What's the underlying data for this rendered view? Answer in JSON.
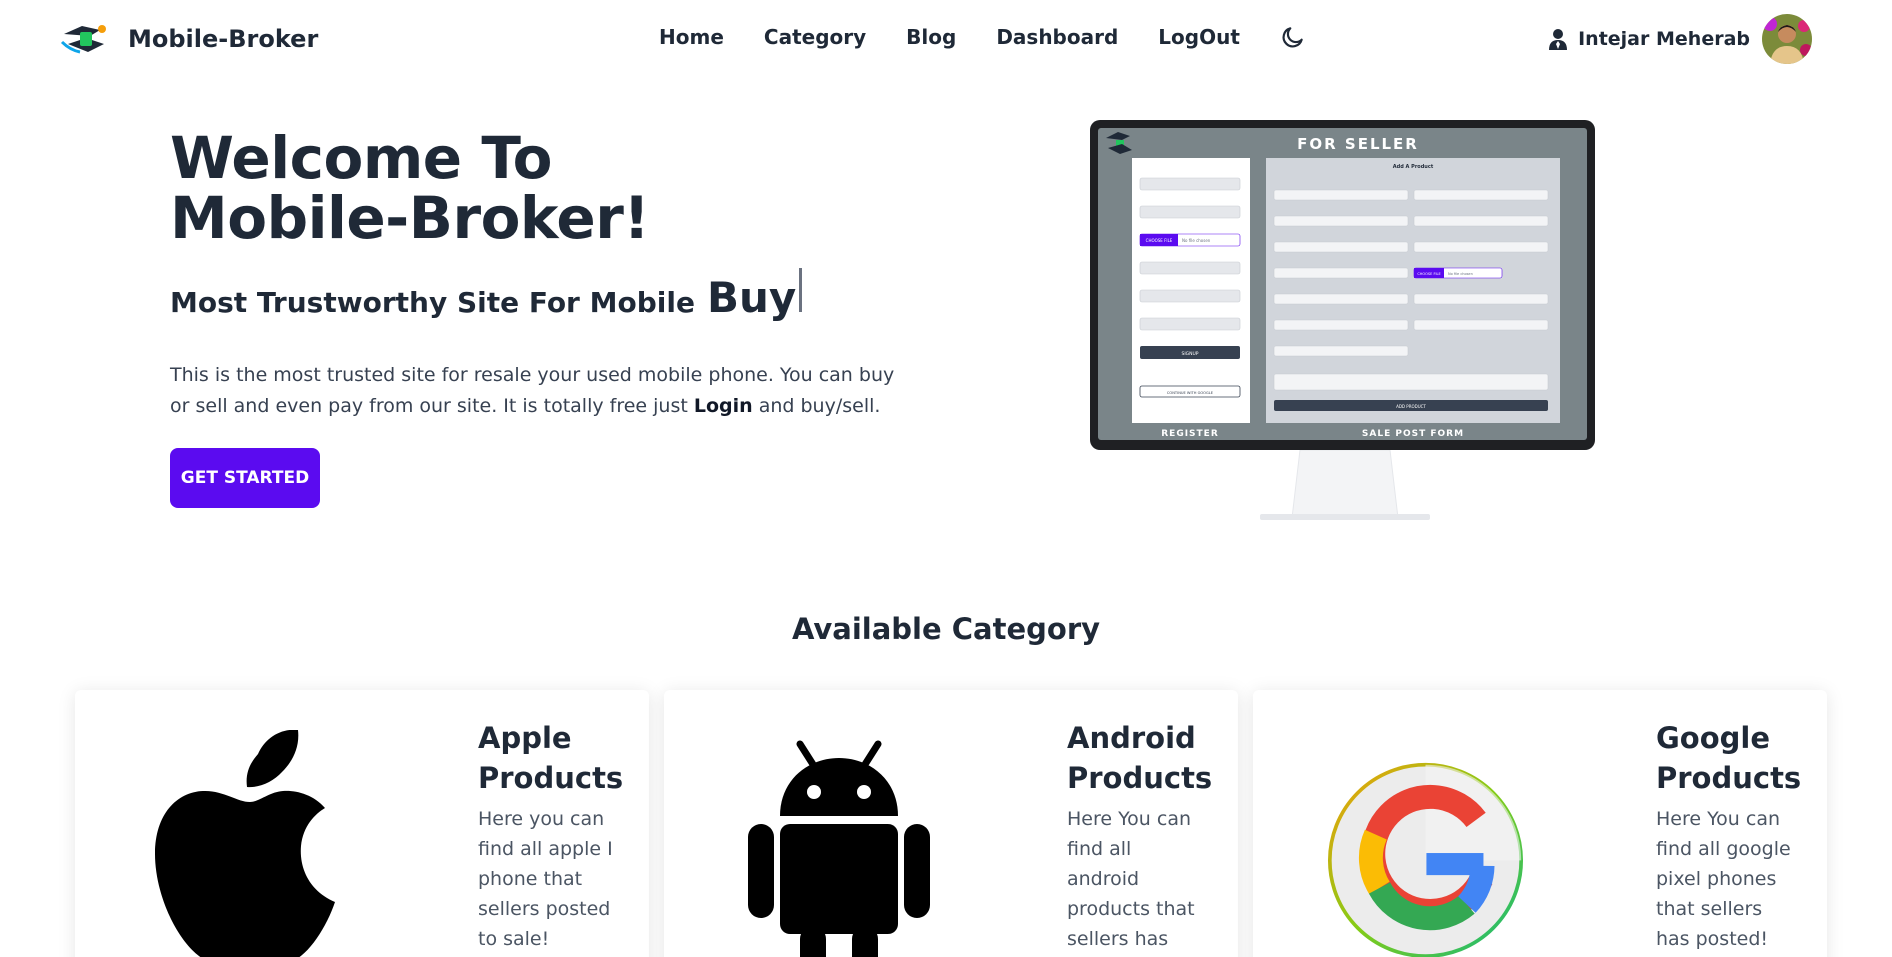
{
  "nav": {
    "brand": "Mobile-Broker",
    "links": [
      "Home",
      "Category",
      "Blog",
      "Dashboard",
      "LogOut"
    ],
    "user_name": "Intejar Meherab"
  },
  "hero": {
    "title": "Welcome To Mobile-Broker!",
    "subtitle": "Most Trustworthy Site For Mobile",
    "typed_word": "Buy",
    "description_part1": "This is the most trusted site for resale your used mobile phone. You can buy or sell and even pay from our site. It is totally free just",
    "description_bold": "Login",
    "description_part2": "and buy/sell.",
    "cta": "GET STARTED"
  },
  "showcase": {
    "left_caption": "REGISTER",
    "right_caption": "SALE POST FORM",
    "banner": "FOR SELLER",
    "form_title": "Add A Product",
    "register_button": "SIGNUP",
    "google_button": "CONTINUE WITH GOOGLE",
    "add_button": "ADD PRODUCT",
    "choose_file": "CHOOSE FILE",
    "no_file": "No file chosen"
  },
  "category": {
    "title": "Available Category",
    "cards": [
      {
        "title": "Apple Products",
        "text": "Here you can find all apple I phone that sellers posted to sale!"
      },
      {
        "title": "Android Products",
        "text": "Here You can find all android products that sellers has"
      },
      {
        "title": "Google Products",
        "text": "Here You can find all google pixel phones that sellers has posted!"
      }
    ]
  },
  "colors": {
    "primary": "#5b0bf0",
    "text": "#1f2937",
    "screen_bg": "#7a8589"
  },
  "icons": [
    "logo-icon",
    "moon-icon",
    "user-icon",
    "apple-icon",
    "android-icon",
    "google-icon"
  ]
}
